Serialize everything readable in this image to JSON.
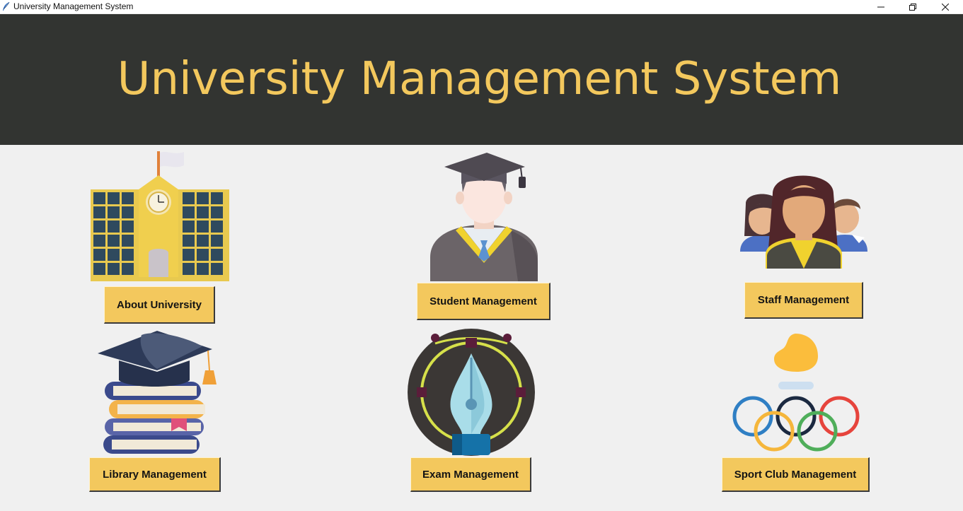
{
  "window": {
    "title": "University Management System",
    "controls": [
      "minimize",
      "restore",
      "close"
    ]
  },
  "header": {
    "title": "University Management System",
    "background": "#323431",
    "title_color": "#f3c85d"
  },
  "modules": [
    {
      "label": "About University",
      "icon": "university-building-icon"
    },
    {
      "label": "Student Management",
      "icon": "graduate-student-icon"
    },
    {
      "label": "Staff Management",
      "icon": "staff-group-icon"
    },
    {
      "label": "Library Management",
      "icon": "library-books-icon"
    },
    {
      "label": "Exam Management",
      "icon": "pen-nib-icon"
    },
    {
      "label": "Sport Club Management",
      "icon": "olympic-rings-icon"
    }
  ],
  "colors": {
    "page_background": "#f0f0f0",
    "button_background": "#f3c85d",
    "button_text": "#141414"
  }
}
